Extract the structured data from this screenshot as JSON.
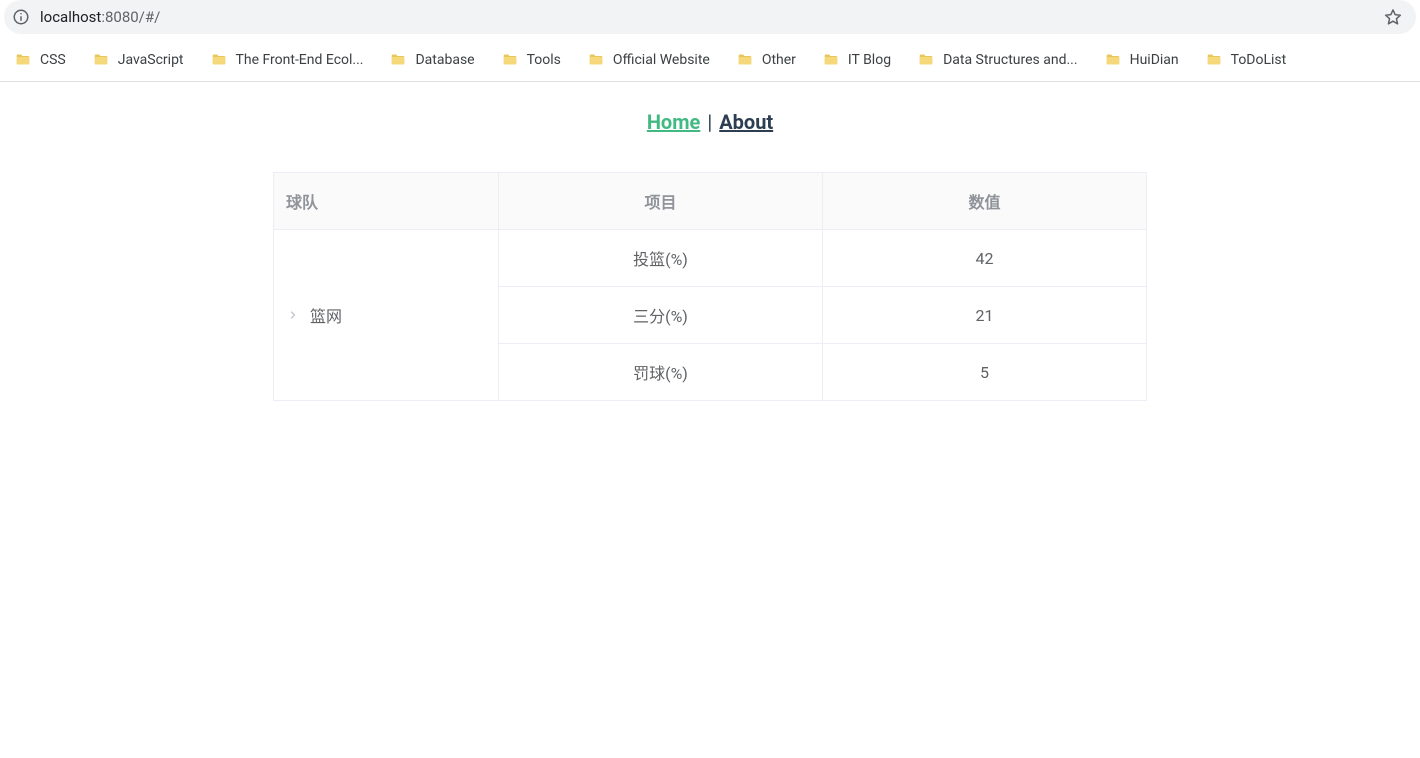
{
  "address_bar": {
    "host": "localhost",
    "port_path": ":8080/#/"
  },
  "bookmarks": [
    {
      "label": "CSS"
    },
    {
      "label": "JavaScript"
    },
    {
      "label": "The Front-End Ecol..."
    },
    {
      "label": "Database"
    },
    {
      "label": "Tools"
    },
    {
      "label": "Official Website"
    },
    {
      "label": "Other"
    },
    {
      "label": "IT Blog"
    },
    {
      "label": "Data Structures and..."
    },
    {
      "label": "HuiDian"
    },
    {
      "label": "ToDoList"
    }
  ],
  "nav": {
    "home": "Home",
    "separator": "|",
    "about": "About"
  },
  "table": {
    "headers": {
      "team": "球队",
      "item": "项目",
      "value": "数值"
    },
    "team_name": "篮网",
    "rows": [
      {
        "item": "投篮(%)",
        "value": "42"
      },
      {
        "item": "三分(%)",
        "value": "21"
      },
      {
        "item": "罚球(%)",
        "value": "5"
      }
    ]
  }
}
